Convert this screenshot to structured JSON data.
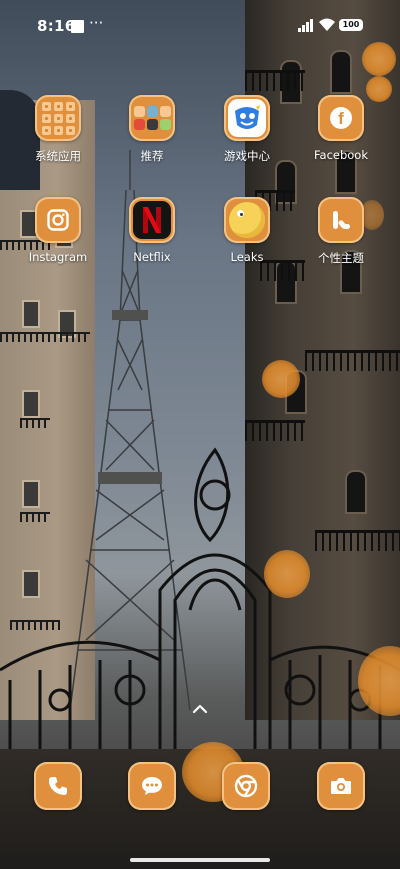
{
  "status_bar": {
    "time": "8:16",
    "overflow_dots": "···",
    "battery_level": "100"
  },
  "apps": [
    {
      "label": "系统应用",
      "icon": "folder-icon"
    },
    {
      "label": "推荐",
      "icon": "folder-icon"
    },
    {
      "label": "游戏中心",
      "icon": "game-center-icon"
    },
    {
      "label": "Facebook",
      "icon": "facebook-icon"
    },
    {
      "label": "Instagram",
      "icon": "instagram-icon"
    },
    {
      "label": "Netflix",
      "icon": "netflix-icon"
    },
    {
      "label": "Leaks",
      "icon": "leaks-icon"
    },
    {
      "label": "个性主题",
      "icon": "themes-icon"
    }
  ],
  "dock": [
    {
      "icon": "phone-icon"
    },
    {
      "icon": "messages-icon"
    },
    {
      "icon": "chrome-icon"
    },
    {
      "icon": "camera-icon"
    }
  ],
  "theme": {
    "icon_bg": "#e0903d",
    "icon_border": "#f2c384"
  }
}
